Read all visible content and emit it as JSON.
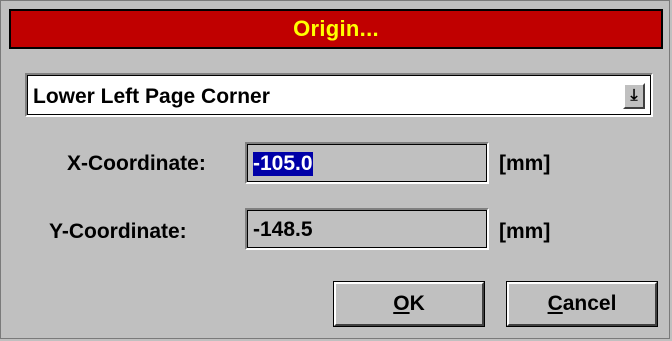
{
  "dialog": {
    "title": "Origin...",
    "origin_select": {
      "value": "Lower Left Page Corner",
      "dropdown_icon": "dropdown-arrow-icon"
    },
    "x": {
      "label": "X-Coordinate:",
      "value": "-105.0",
      "unit": "[mm]"
    },
    "y": {
      "label": "Y-Coordinate:",
      "value": "-148.5",
      "unit": "[mm]"
    },
    "ok_label": {
      "mnemonic": "O",
      "rest": "K"
    },
    "cancel_label": {
      "mnemonic": "C",
      "rest": "ancel"
    },
    "colors": {
      "title_bar": "#c00000",
      "title_text": "#ffff00",
      "face": "#c0c0c0",
      "selection": "#0000a8"
    }
  }
}
